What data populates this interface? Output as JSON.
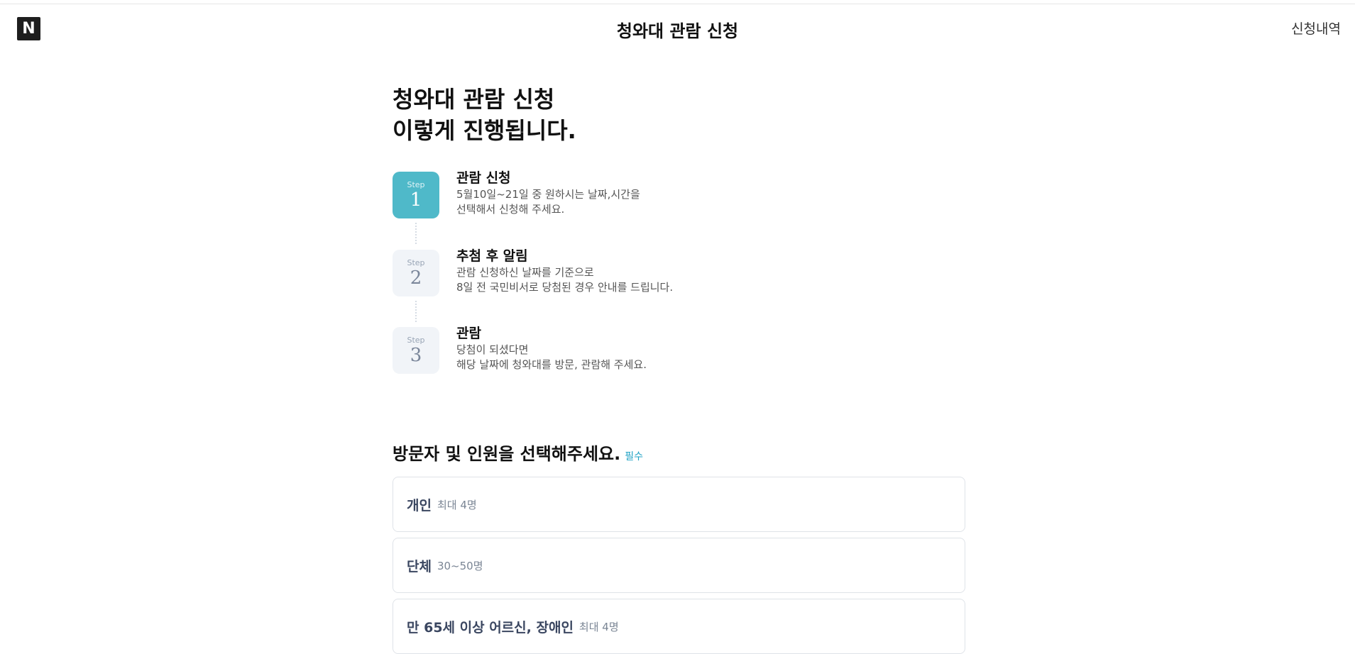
{
  "header": {
    "logo_letter": "N",
    "title": "청와대 관람 신청",
    "history_link": "신청내역"
  },
  "intro": {
    "line1": "청와대 관람 신청",
    "line2": "이렇게 진행됩니다."
  },
  "steps": [
    {
      "badge_label": "Step",
      "number": "1",
      "title": "관람 신청",
      "desc_line1": "5월10일~21일 중 원하시는 날짜,시간을",
      "desc_line2": "선택해서 신청해 주세요.",
      "active": true
    },
    {
      "badge_label": "Step",
      "number": "2",
      "title": "추첨 후 알림",
      "desc_line1": "관람 신청하신 날짜를 기준으로",
      "desc_line2": "8일 전 국민비서로 당첨된 경우 안내를 드립니다.",
      "active": false
    },
    {
      "badge_label": "Step",
      "number": "3",
      "title": "관람",
      "desc_line1": "당첨이 되셨다면",
      "desc_line2": "해당 날짜에 청와대를 방문, 관람해 주세요.",
      "active": false
    }
  ],
  "visitor_section": {
    "title": "방문자 및 인원을 선택해주세요.",
    "required": "필수",
    "options": [
      {
        "name": "개인",
        "capacity": "최대 4명"
      },
      {
        "name": "단체",
        "capacity": "30~50명"
      },
      {
        "name": "만 65세 이상 어르신, 장애인",
        "capacity": "최대 4명"
      }
    ]
  },
  "colors": {
    "active_step": "#4fb9c9",
    "inactive_step": "#f1f4f8",
    "required_accent": "#1da1c4"
  }
}
